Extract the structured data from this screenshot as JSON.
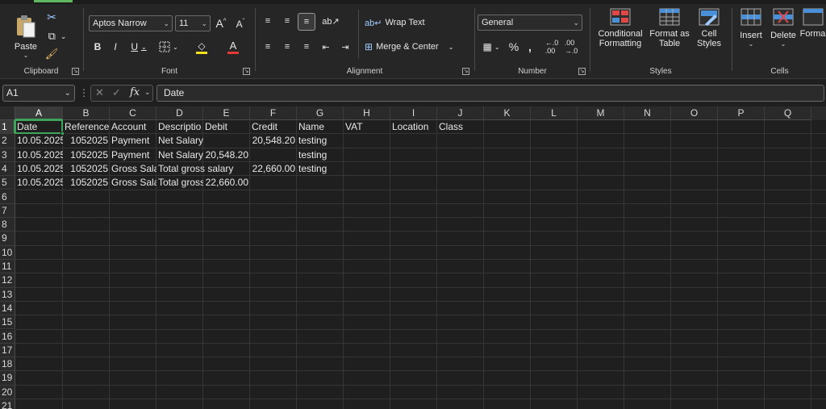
{
  "ribbon": {
    "clipboard": {
      "paste": "Paste",
      "label": "Clipboard"
    },
    "font": {
      "name": "Aptos Narrow",
      "size": "11",
      "bold": "B",
      "italic": "I",
      "underline": "U",
      "label": "Font"
    },
    "alignment": {
      "wrap_text": "Wrap Text",
      "merge_center": "Merge & Center",
      "label": "Alignment"
    },
    "number": {
      "format": "General",
      "label": "Number"
    },
    "styles": {
      "conditional_l1": "Conditional",
      "conditional_l2": "Formatting",
      "format_table_l1": "Format as",
      "format_table_l2": "Table",
      "cell_styles_l1": "Cell",
      "cell_styles_l2": "Styles",
      "label": "Styles"
    },
    "cells": {
      "insert": "Insert",
      "delete": "Delete",
      "format": "Forma",
      "label": "Cells"
    }
  },
  "formula_bar": {
    "name_box": "A1",
    "fx": "fx",
    "content": "Date"
  },
  "colors": {
    "accent": "#3fa35b",
    "background": "#1f1f1f",
    "ribbon": "#262626"
  },
  "columns": [
    "A",
    "B",
    "C",
    "D",
    "E",
    "F",
    "G",
    "H",
    "I",
    "J",
    "K",
    "L",
    "M",
    "N",
    "O",
    "P",
    "Q"
  ],
  "rows": [
    "1",
    "2",
    "3",
    "4",
    "5",
    "6",
    "7",
    "8",
    "9",
    "10",
    "11",
    "12",
    "13",
    "14",
    "15",
    "16",
    "17",
    "18",
    "19",
    "20",
    "21"
  ],
  "sheet": {
    "r1": {
      "A": "Date",
      "B": "Reference",
      "C": "Account",
      "D": "Descriptio",
      "E": "Debit",
      "F": "Credit",
      "G": "Name",
      "H": "VAT",
      "I": "Location",
      "J": "Class"
    },
    "r2": {
      "A": "10.05.2025",
      "B": "1052025",
      "C": "Payment",
      "D": "Net Salary",
      "E": "",
      "F": "20,548.20",
      "G": "testing"
    },
    "r3": {
      "A": "10.05.2025",
      "B": "1052025",
      "C": "Payment",
      "D": "Net Salary",
      "E": "20,548.20",
      "F": "",
      "G": "testing"
    },
    "r4": {
      "A": "10.05.2025",
      "B": "1052025",
      "C": "Gross Sala",
      "D": "Total gross salary",
      "E": "",
      "F": "22,660.00",
      "G": "testing"
    },
    "r5": {
      "A": "10.05.2025",
      "B": "1052025",
      "C": "Gross Sala",
      "D": "Total gross",
      "E": "22,660.00",
      "F": "",
      "G": ""
    }
  }
}
